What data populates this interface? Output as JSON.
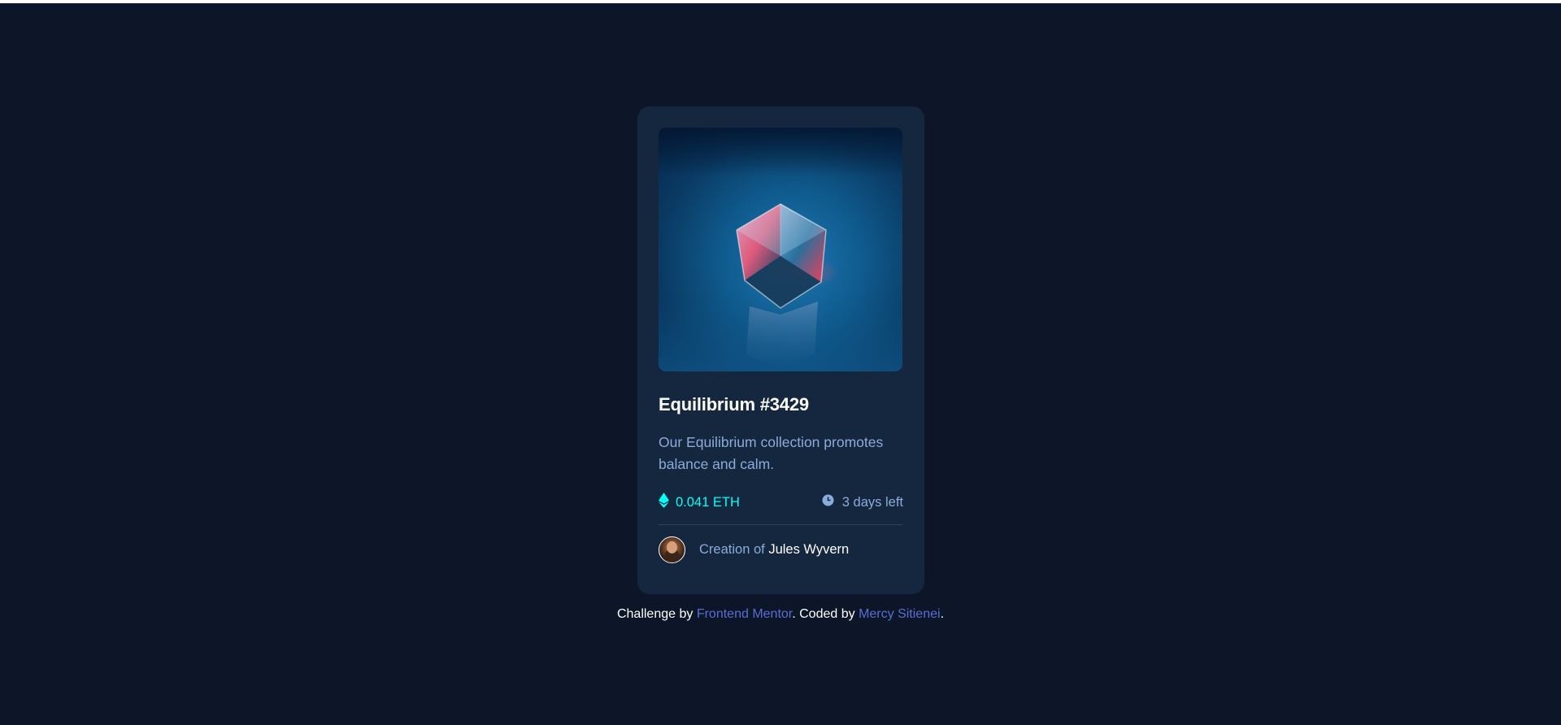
{
  "card": {
    "title": "Equilibrium #3429",
    "description": "Our Equilibrium collection promotes balance and calm.",
    "price": "0.041 ETH",
    "time_left": "3 days left",
    "creator_prefix": "Creation of",
    "creator_name": "Jules Wyvern",
    "icons": {
      "image": "cube-image",
      "price": "ethereum-icon",
      "time": "clock-icon",
      "avatar": "avatar"
    }
  },
  "attribution": {
    "prefix": "Challenge by",
    "link1": "Frontend Mentor",
    "middle": ". Coded by",
    "link2": "Mercy Sitienei",
    "suffix": "."
  },
  "colors": {
    "background": "#0d1628",
    "card": "#15263f",
    "accent": "#00fff8",
    "muted": "#8bacda",
    "link": "#5a6ed1"
  }
}
